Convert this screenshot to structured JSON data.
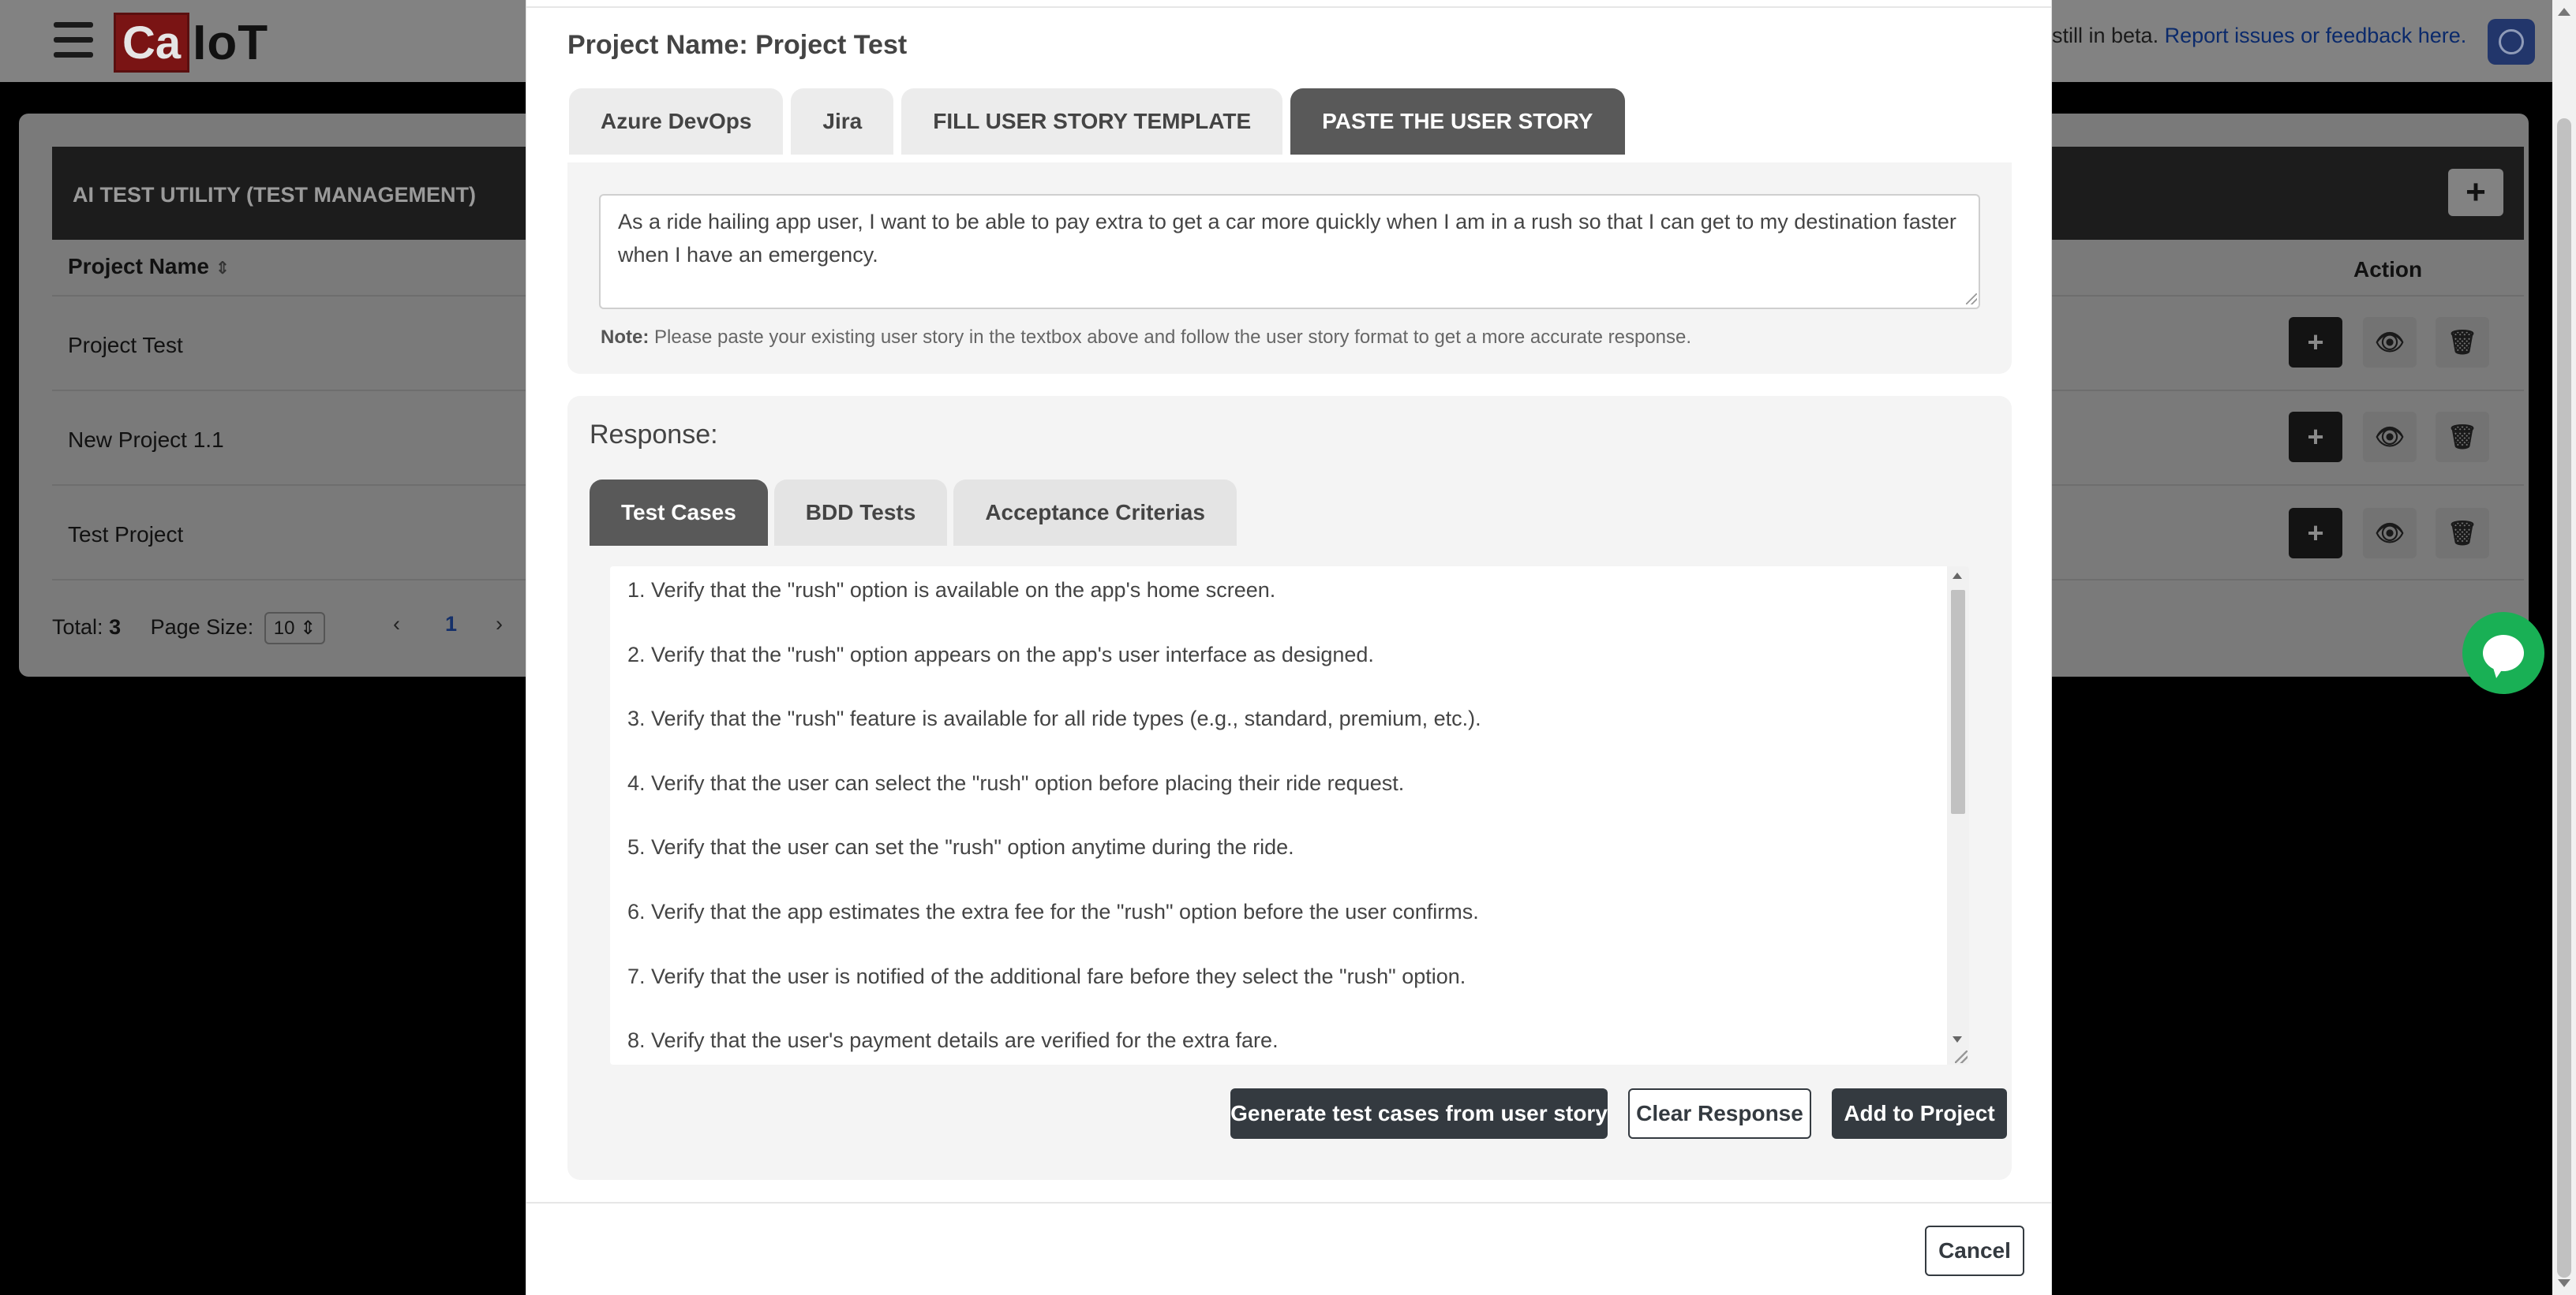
{
  "header": {
    "logo_left": "Ca",
    "logo_right": "IoT",
    "beta_text": "still in beta.",
    "report_link": "Report issues or feedback here."
  },
  "background_table": {
    "title": "AI TEST UTILITY (TEST MANAGEMENT)",
    "col_project_name": "Project Name",
    "col_action": "Action",
    "rows": [
      {
        "name": "Project Test"
      },
      {
        "name": "New Project 1.1"
      },
      {
        "name": "Test Project"
      }
    ],
    "footer": {
      "total_label": "Total:",
      "total_value": "3",
      "page_size_label": "Page Size:",
      "page_size_value": "10",
      "current_page": "1",
      "prev": "‹",
      "next": "›"
    },
    "add_symbol": "+",
    "sort_symbol": "⇕"
  },
  "modal": {
    "title": "Project Name: Project Test",
    "tabs": [
      {
        "label": "Azure DevOps",
        "active": false
      },
      {
        "label": "Jira",
        "active": false
      },
      {
        "label": "FILL USER STORY TEMPLATE",
        "active": false
      },
      {
        "label": "PASTE THE USER STORY",
        "active": true
      }
    ],
    "story_text": "As a ride hailing app user, I want to be able to pay extra to get a car more quickly when I am in a rush so that I can get to my destination faster when I have an emergency.",
    "note_label": "Note:",
    "note_text": "Please paste your existing user story in the textbox above and follow the user story format to get a more accurate response.",
    "response_label": "Response:",
    "response_tabs": [
      {
        "label": "Test Cases",
        "active": true
      },
      {
        "label": "BDD Tests",
        "active": false
      },
      {
        "label": "Acceptance Criterias",
        "active": false
      }
    ],
    "test_cases": [
      "1. Verify that the \"rush\" option is available on the app's home screen.",
      "2. Verify that the \"rush\" option appears on the app's user interface as designed.",
      "3. Verify that the \"rush\" feature is available for all ride types (e.g., standard, premium, etc.).",
      "4. Verify that the user can select the \"rush\" option before placing their ride request.",
      "5. Verify that the user can set the \"rush\" option anytime during the ride.",
      "6. Verify that the app estimates the extra fee for the \"rush\" option before the user confirms.",
      "7. Verify that the user is notified of the additional fare before they select the \"rush\" option.",
      "8. Verify that the user's payment details are verified for the extra fare."
    ],
    "buttons": {
      "generate": "Generate test cases from user story",
      "clear": "Clear Response",
      "add": "Add to Project",
      "cancel": "Cancel"
    }
  }
}
